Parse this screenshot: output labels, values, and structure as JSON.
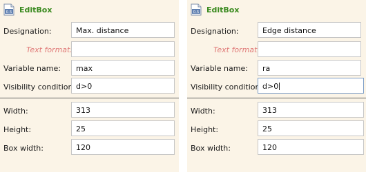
{
  "panels": [
    {
      "title": "EditBox",
      "icon_badge": "0.5",
      "fields": {
        "designation": {
          "label": "Designation:",
          "value": "Max. distance"
        },
        "text_format": {
          "label": "Text format:",
          "value": ""
        },
        "variable_name": {
          "label": "Variable name:",
          "value": "max"
        },
        "visibility_condition": {
          "label": "Visibility condition:",
          "value": "d>0"
        },
        "width": {
          "label": "Width:",
          "value": "313"
        },
        "height": {
          "label": "Height:",
          "value": "25"
        },
        "box_width": {
          "label": "Box width:",
          "value": "120"
        }
      }
    },
    {
      "title": "EditBox",
      "icon_badge": "0.5",
      "fields": {
        "designation": {
          "label": "Designation:",
          "value": "Edge distance"
        },
        "text_format": {
          "label": "Text format:",
          "value": ""
        },
        "variable_name": {
          "label": "Variable name:",
          "value": "ra"
        },
        "visibility_condition": {
          "label": "Visibility condition:",
          "value": "d>0"
        },
        "width": {
          "label": "Width:",
          "value": "313"
        },
        "height": {
          "label": "Height:",
          "value": "25"
        },
        "box_width": {
          "label": "Box width:",
          "value": "120"
        }
      }
    }
  ],
  "colors": {
    "panel_bg": "#fbf4e7",
    "title_green": "#3a8a1f",
    "muted_label": "#e07a78",
    "separator": "#5f5f5f",
    "input_border": "#c6c6c6",
    "focus_border": "#7a9cc6"
  },
  "icons": {
    "header": "document-badge-icon"
  }
}
